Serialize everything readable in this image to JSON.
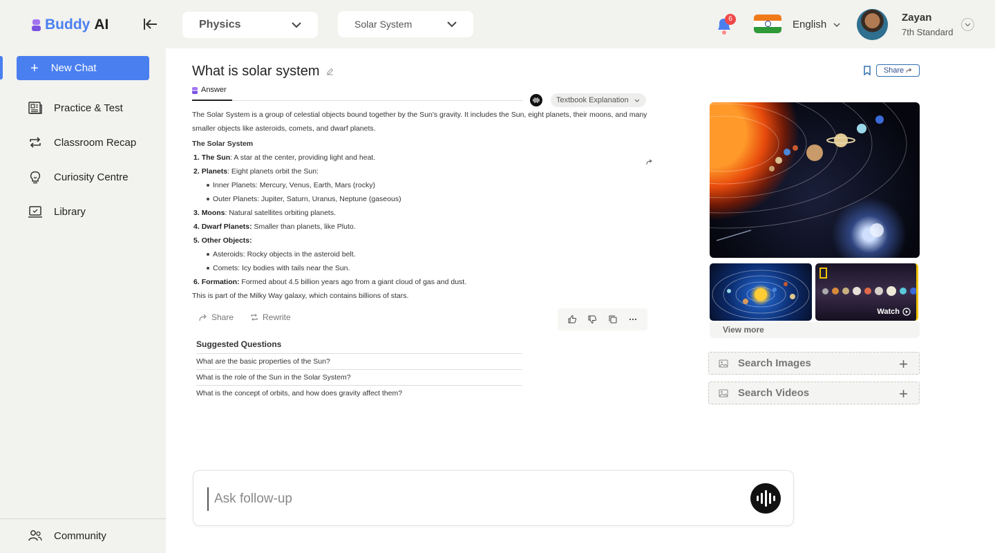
{
  "header": {
    "logo_buddy": "Buddy",
    "logo_ai": "AI",
    "subject": "Physics",
    "topic": "Solar System",
    "notification_count": "6",
    "language": "English",
    "user_name": "Zayan",
    "user_grade": "7th Standard"
  },
  "sidebar": {
    "new_chat": "New Chat",
    "items": [
      {
        "label": "Practice & Test",
        "icon": "newspaper-icon"
      },
      {
        "label": "Classroom Recap",
        "icon": "repeat-icon"
      },
      {
        "label": "Curiosity Centre",
        "icon": "lightbulb-icon"
      },
      {
        "label": "Library",
        "icon": "laptop-icon"
      }
    ],
    "community": "Community"
  },
  "main": {
    "question": "What is solar system",
    "share_top": "Share",
    "tab_answer": "Answer",
    "explanation_mode": "Textbook Explanation",
    "intro": "The Solar System is a group of celestial objects bound together by the Sun's gravity. It includes the Sun, eight planets, their moons, and many smaller objects like asteroids, comets, and dwarf planets.",
    "heading": "The Solar System",
    "items": [
      {
        "num": "1.",
        "term": "The Sun",
        "text": ": A star at the center, providing light and heat."
      },
      {
        "num": "2.",
        "term": "Planets",
        "text": ": Eight planets orbit the Sun:"
      },
      {
        "num": "3.",
        "term": "Moons",
        "text": ": Natural satellites orbiting planets."
      },
      {
        "num": "4.",
        "term": "Dwarf Planets:",
        "text": " Smaller than planets, like Pluto."
      },
      {
        "num": "5.",
        "term": "Other Objects:",
        "text": ""
      },
      {
        "num": "6.",
        "term": "Formation:",
        "text": " Formed about 4.5 billion years ago from a giant cloud of gas and dust."
      }
    ],
    "planet_bullets": [
      "Inner Planets: Mercury, Venus, Earth, Mars (rocky)",
      "Outer Planets: Jupiter, Saturn, Uranus, Neptune (gaseous)"
    ],
    "other_bullets": [
      "Asteroids: Rocky objects in the asteroid belt.",
      "Comets: Icy bodies with tails near the Sun."
    ],
    "closing": "This is part of the Milky Way galaxy, which contains billions of stars.",
    "action_share": "Share",
    "action_rewrite": "Rewrite",
    "suggested_title": "Suggested Questions",
    "suggested": [
      "What are the basic properties of the Sun?",
      "What is the role of the Sun in the Solar System?",
      "What is the concept of orbits, and how does gravity affect them?"
    ]
  },
  "media": {
    "watch_label": "Watch",
    "view_more": "View more",
    "search_images": "Search Images",
    "search_videos": "Search Videos"
  },
  "followup": {
    "placeholder": "Ask follow-up"
  },
  "colors": {
    "accent": "#4a7ff0",
    "sidebar_bg": "#f2f2ee",
    "badge": "#f04848"
  }
}
